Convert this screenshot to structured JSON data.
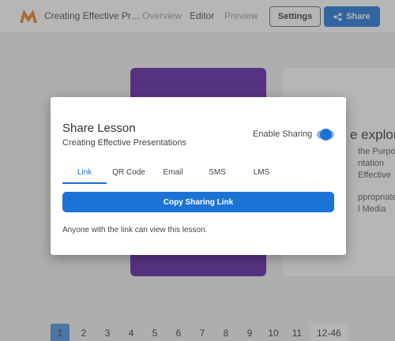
{
  "header": {
    "doc_title": "Creating Effective Presentations",
    "nav": [
      "Overview",
      "Editor",
      "Preview"
    ],
    "settings_label": "Settings",
    "share_label": "Share"
  },
  "background": {
    "card_heading": "e explor",
    "card_lines": [
      "the Purpose",
      "ntation",
      "Effective",
      "ppropriate",
      "l Media"
    ]
  },
  "pagination": {
    "pages": [
      "1",
      "2",
      "3",
      "4",
      "5",
      "6",
      "7",
      "8",
      "9",
      "10",
      "11"
    ],
    "range_label": "12-46",
    "current_page": "1"
  },
  "modal": {
    "title": "Share Lesson",
    "subtitle": "Creating Effective Presentations",
    "toggle_label": "Enable Sharing",
    "toggle_on": true,
    "tabs": [
      "Link",
      "QR Code",
      "Email",
      "SMS",
      "LMS"
    ],
    "active_tab": "Link",
    "copy_button_label": "Copy Sharing Link",
    "note": "Anyone with the link can view this lesson."
  },
  "colors": {
    "accent": "#1c73d6",
    "slide_purple": "#5b1ea3",
    "logo_orange": "#f07d1a"
  },
  "icons": [
    "logo-icon",
    "share-icon"
  ]
}
